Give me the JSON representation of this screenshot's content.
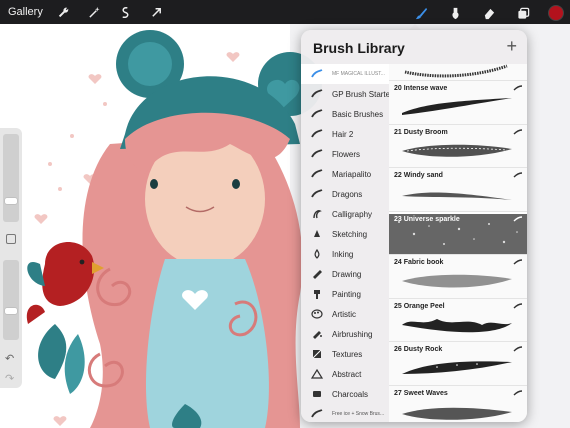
{
  "toolbar": {
    "gallery_label": "Gallery",
    "left_tools": [
      "wrench-icon",
      "magic-wand-icon",
      "selection-icon",
      "transform-arrow-icon"
    ],
    "right_tools": [
      "brush-icon",
      "smudge-icon",
      "eraser-icon",
      "layers-icon"
    ],
    "current_color": "#b3121d",
    "accent_color": "#3b8fe8"
  },
  "brush_library": {
    "title": "Brush Library",
    "add_label": "+",
    "sets": [
      {
        "label": "MF MAGICAL ILLUST...",
        "icon": "brush-stroke-icon"
      },
      {
        "label": "GP Brush Starters",
        "icon": "brush-stroke-icon"
      },
      {
        "label": "Basic Brushes",
        "icon": "brush-stroke-icon"
      },
      {
        "label": "Hair 2",
        "icon": "brush-stroke-icon"
      },
      {
        "label": "Flowers",
        "icon": "brush-stroke-icon"
      },
      {
        "label": "Mariapalito",
        "icon": "brush-stroke-icon"
      },
      {
        "label": "Dragons",
        "icon": "brush-stroke-icon"
      },
      {
        "label": "Calligraphy",
        "icon": "calligraphy-icon"
      },
      {
        "label": "Sketching",
        "icon": "pencil-tip-icon"
      },
      {
        "label": "Inking",
        "icon": "ink-drop-icon"
      },
      {
        "label": "Drawing",
        "icon": "drawing-icon"
      },
      {
        "label": "Painting",
        "icon": "paint-brush-icon"
      },
      {
        "label": "Artistic",
        "icon": "palette-icon"
      },
      {
        "label": "Airbrushing",
        "icon": "airbrush-icon"
      },
      {
        "label": "Textures",
        "icon": "texture-icon"
      },
      {
        "label": "Abstract",
        "icon": "triangle-icon"
      },
      {
        "label": "Charcoals",
        "icon": "charcoal-icon"
      },
      {
        "label": "Free ice + Snow Brus...",
        "icon": "brush-stroke-icon"
      }
    ],
    "brushes": [
      {
        "name": ""
      },
      {
        "name": "20 Intense wave"
      },
      {
        "name": "21 Dusty Broom"
      },
      {
        "name": "22 Windy sand"
      },
      {
        "name": "23 Universe sparkle"
      },
      {
        "name": "24 Fabric book"
      },
      {
        "name": "25 Orange Peel"
      },
      {
        "name": "26 Dusty Rock"
      },
      {
        "name": "27 Sweet Waves"
      }
    ]
  }
}
